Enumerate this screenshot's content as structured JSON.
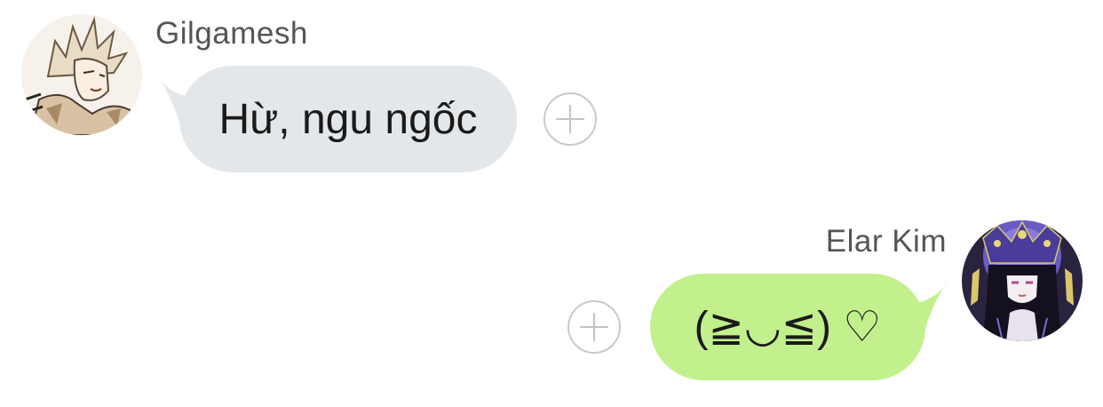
{
  "messages": [
    {
      "sender": "Gilgamesh",
      "text": "Hừ, ngu ngốc",
      "direction": "incoming",
      "bubble_color": "#e4e7ea",
      "avatar_icon": "blond-character-avatar-icon"
    },
    {
      "sender": "Elar Kim",
      "text": "(≧◡≦) ♡",
      "direction": "outgoing",
      "bubble_color": "#c2f08c",
      "avatar_icon": "dark-hair-character-avatar-icon"
    }
  ],
  "colors": {
    "sender_text": "#555555",
    "add_button_border": "#c9c9c9",
    "background": "#ffffff"
  },
  "icons": {
    "add": "plus-circle-icon"
  }
}
